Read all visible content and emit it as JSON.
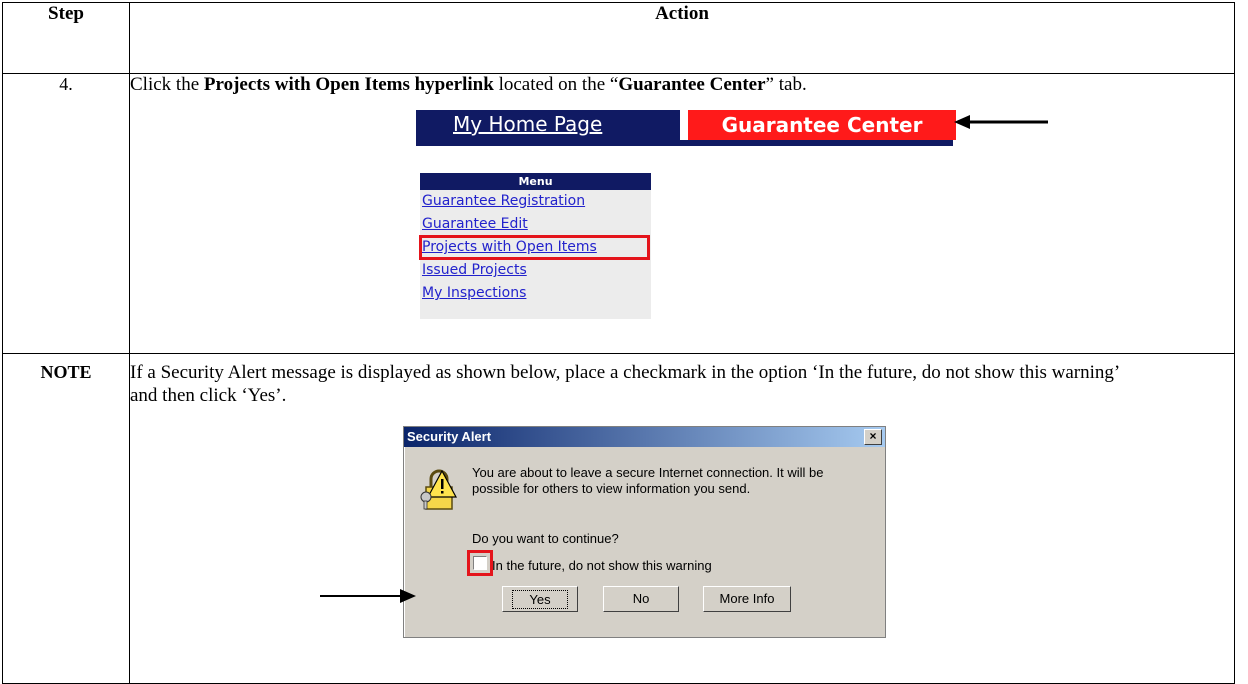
{
  "headers": {
    "step": "Step",
    "action": "Action"
  },
  "row4": {
    "step": "4.",
    "text_1": "Click the ",
    "text_bold": "Projects with Open Items hyperlink",
    "text_2": " located on the “",
    "text_tab": "Guarantee Center",
    "text_3": "” tab.",
    "tab_home": "My Home Page",
    "tab_gc": "Guarantee Center",
    "menu_header": "Menu",
    "menu_items": [
      "Guarantee Registration",
      "Guarantee Edit",
      "Projects with Open Items",
      "Issued Projects",
      "My Inspections"
    ]
  },
  "note": {
    "step": "NOTE",
    "text": "If a Security Alert message is displayed as shown below, place a checkmark in the option ‘In the future, do not show this warning’ and then click ‘Yes’.",
    "dialog": {
      "title": "Security Alert",
      "close": "×",
      "message": "You are about to leave a secure Internet connection.  It will be possible for others to view information you send.",
      "question": "Do you want to continue?",
      "checkbox_label": "In the future, do not show this warning",
      "btn_yes": "Yes",
      "btn_no": "No",
      "btn_more": "More Info"
    }
  },
  "colors": {
    "nav_blue": "#101a63",
    "tab_red": "#ff1a1a",
    "highlight_red": "#e4141b",
    "link_blue": "#2222cc"
  }
}
